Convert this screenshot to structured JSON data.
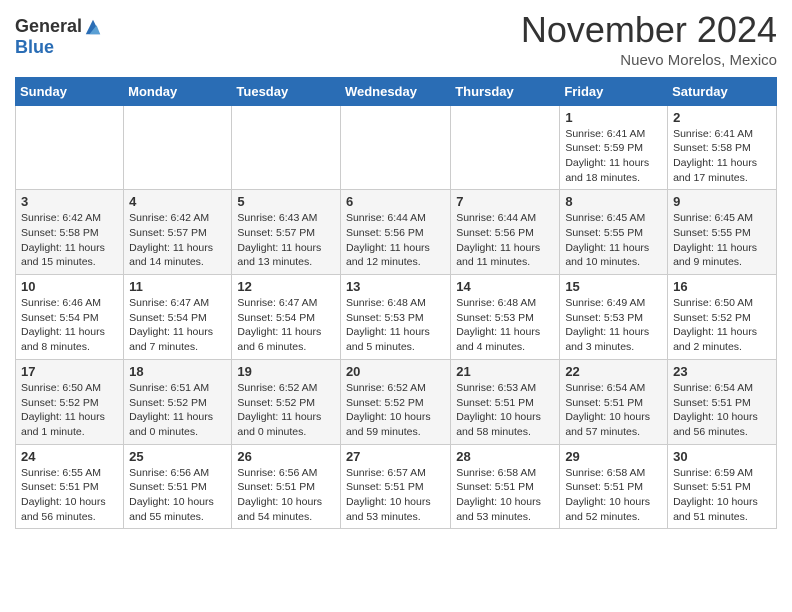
{
  "header": {
    "logo_general": "General",
    "logo_blue": "Blue",
    "month_title": "November 2024",
    "location": "Nuevo Morelos, Mexico"
  },
  "weekdays": [
    "Sunday",
    "Monday",
    "Tuesday",
    "Wednesday",
    "Thursday",
    "Friday",
    "Saturday"
  ],
  "weeks": [
    [
      {
        "day": "",
        "info": ""
      },
      {
        "day": "",
        "info": ""
      },
      {
        "day": "",
        "info": ""
      },
      {
        "day": "",
        "info": ""
      },
      {
        "day": "",
        "info": ""
      },
      {
        "day": "1",
        "info": "Sunrise: 6:41 AM\nSunset: 5:59 PM\nDaylight: 11 hours and 18 minutes."
      },
      {
        "day": "2",
        "info": "Sunrise: 6:41 AM\nSunset: 5:58 PM\nDaylight: 11 hours and 17 minutes."
      }
    ],
    [
      {
        "day": "3",
        "info": "Sunrise: 6:42 AM\nSunset: 5:58 PM\nDaylight: 11 hours and 15 minutes."
      },
      {
        "day": "4",
        "info": "Sunrise: 6:42 AM\nSunset: 5:57 PM\nDaylight: 11 hours and 14 minutes."
      },
      {
        "day": "5",
        "info": "Sunrise: 6:43 AM\nSunset: 5:57 PM\nDaylight: 11 hours and 13 minutes."
      },
      {
        "day": "6",
        "info": "Sunrise: 6:44 AM\nSunset: 5:56 PM\nDaylight: 11 hours and 12 minutes."
      },
      {
        "day": "7",
        "info": "Sunrise: 6:44 AM\nSunset: 5:56 PM\nDaylight: 11 hours and 11 minutes."
      },
      {
        "day": "8",
        "info": "Sunrise: 6:45 AM\nSunset: 5:55 PM\nDaylight: 11 hours and 10 minutes."
      },
      {
        "day": "9",
        "info": "Sunrise: 6:45 AM\nSunset: 5:55 PM\nDaylight: 11 hours and 9 minutes."
      }
    ],
    [
      {
        "day": "10",
        "info": "Sunrise: 6:46 AM\nSunset: 5:54 PM\nDaylight: 11 hours and 8 minutes."
      },
      {
        "day": "11",
        "info": "Sunrise: 6:47 AM\nSunset: 5:54 PM\nDaylight: 11 hours and 7 minutes."
      },
      {
        "day": "12",
        "info": "Sunrise: 6:47 AM\nSunset: 5:54 PM\nDaylight: 11 hours and 6 minutes."
      },
      {
        "day": "13",
        "info": "Sunrise: 6:48 AM\nSunset: 5:53 PM\nDaylight: 11 hours and 5 minutes."
      },
      {
        "day": "14",
        "info": "Sunrise: 6:48 AM\nSunset: 5:53 PM\nDaylight: 11 hours and 4 minutes."
      },
      {
        "day": "15",
        "info": "Sunrise: 6:49 AM\nSunset: 5:53 PM\nDaylight: 11 hours and 3 minutes."
      },
      {
        "day": "16",
        "info": "Sunrise: 6:50 AM\nSunset: 5:52 PM\nDaylight: 11 hours and 2 minutes."
      }
    ],
    [
      {
        "day": "17",
        "info": "Sunrise: 6:50 AM\nSunset: 5:52 PM\nDaylight: 11 hours and 1 minute."
      },
      {
        "day": "18",
        "info": "Sunrise: 6:51 AM\nSunset: 5:52 PM\nDaylight: 11 hours and 0 minutes."
      },
      {
        "day": "19",
        "info": "Sunrise: 6:52 AM\nSunset: 5:52 PM\nDaylight: 11 hours and 0 minutes."
      },
      {
        "day": "20",
        "info": "Sunrise: 6:52 AM\nSunset: 5:52 PM\nDaylight: 10 hours and 59 minutes."
      },
      {
        "day": "21",
        "info": "Sunrise: 6:53 AM\nSunset: 5:51 PM\nDaylight: 10 hours and 58 minutes."
      },
      {
        "day": "22",
        "info": "Sunrise: 6:54 AM\nSunset: 5:51 PM\nDaylight: 10 hours and 57 minutes."
      },
      {
        "day": "23",
        "info": "Sunrise: 6:54 AM\nSunset: 5:51 PM\nDaylight: 10 hours and 56 minutes."
      }
    ],
    [
      {
        "day": "24",
        "info": "Sunrise: 6:55 AM\nSunset: 5:51 PM\nDaylight: 10 hours and 56 minutes."
      },
      {
        "day": "25",
        "info": "Sunrise: 6:56 AM\nSunset: 5:51 PM\nDaylight: 10 hours and 55 minutes."
      },
      {
        "day": "26",
        "info": "Sunrise: 6:56 AM\nSunset: 5:51 PM\nDaylight: 10 hours and 54 minutes."
      },
      {
        "day": "27",
        "info": "Sunrise: 6:57 AM\nSunset: 5:51 PM\nDaylight: 10 hours and 53 minutes."
      },
      {
        "day": "28",
        "info": "Sunrise: 6:58 AM\nSunset: 5:51 PM\nDaylight: 10 hours and 53 minutes."
      },
      {
        "day": "29",
        "info": "Sunrise: 6:58 AM\nSunset: 5:51 PM\nDaylight: 10 hours and 52 minutes."
      },
      {
        "day": "30",
        "info": "Sunrise: 6:59 AM\nSunset: 5:51 PM\nDaylight: 10 hours and 51 minutes."
      }
    ]
  ]
}
